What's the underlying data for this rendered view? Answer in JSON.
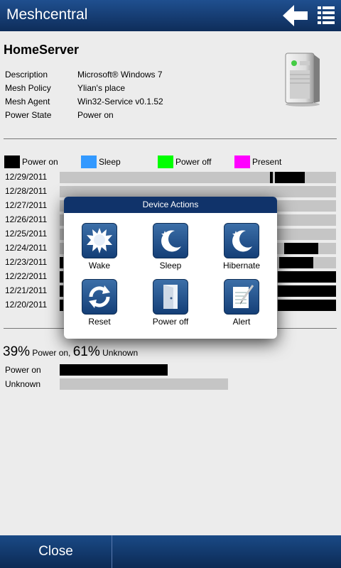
{
  "topbar": {
    "title": "Meshcentral"
  },
  "device": {
    "name": "HomeServer",
    "info": [
      {
        "key": "Description",
        "value": "Microsoft® Windows 7"
      },
      {
        "key": "Mesh Policy",
        "value": "Ylian's place"
      },
      {
        "key": "Mesh Agent",
        "value": "Win32-Service v0.1.52"
      },
      {
        "key": "Power State",
        "value": "Power on"
      }
    ]
  },
  "legend": [
    {
      "label": "Power on",
      "color": "#000000"
    },
    {
      "label": "Sleep",
      "color": "#3399ff"
    },
    {
      "label": "Power off",
      "color": "#00ff00"
    },
    {
      "label": "Present",
      "color": "#ff00ff"
    }
  ],
  "history": [
    {
      "date": "12/29/2011",
      "segments": [
        [
          0.76,
          0.772
        ],
        [
          0.778,
          0.887
        ]
      ]
    },
    {
      "date": "12/28/2011",
      "segments": []
    },
    {
      "date": "12/27/2011",
      "segments": []
    },
    {
      "date": "12/26/2011",
      "segments": []
    },
    {
      "date": "12/25/2011",
      "segments": []
    },
    {
      "date": "12/24/2011",
      "segments": [
        [
          0.813,
          0.935
        ]
      ]
    },
    {
      "date": "12/23/2011",
      "segments": [
        [
          0.0,
          0.012
        ],
        [
          0.795,
          0.917
        ]
      ]
    },
    {
      "date": "12/22/2011",
      "segments": [
        [
          0.0,
          0.012
        ],
        [
          0.79,
          1.0
        ]
      ]
    },
    {
      "date": "12/21/2011",
      "segments": [
        [
          0.0,
          0.012
        ],
        [
          0.79,
          1.0
        ]
      ]
    },
    {
      "date": "12/20/2011",
      "segments": [
        [
          0.0,
          0.012
        ],
        [
          0.79,
          1.0
        ]
      ]
    }
  ],
  "summary": {
    "on_pct": "39%",
    "on_label": " Power on, ",
    "unknown_pct": "61%",
    "unknown_label": " Unknown"
  },
  "stats": [
    {
      "label": "Power on",
      "value": 0.39,
      "color": "#000000"
    },
    {
      "label": "Unknown",
      "value": 0.61,
      "color": "#c5c5c5"
    }
  ],
  "dialog": {
    "title": "Device Actions",
    "actions": [
      {
        "label": "Wake",
        "icon": "sun-icon"
      },
      {
        "label": "Sleep",
        "icon": "moon-icon"
      },
      {
        "label": "Hibernate",
        "icon": "moon-icon"
      },
      {
        "label": "Reset",
        "icon": "refresh-icon"
      },
      {
        "label": "Power off",
        "icon": "door-icon"
      },
      {
        "label": "Alert",
        "icon": "notepad-icon"
      }
    ]
  },
  "bottombar": {
    "close_label": "Close"
  }
}
